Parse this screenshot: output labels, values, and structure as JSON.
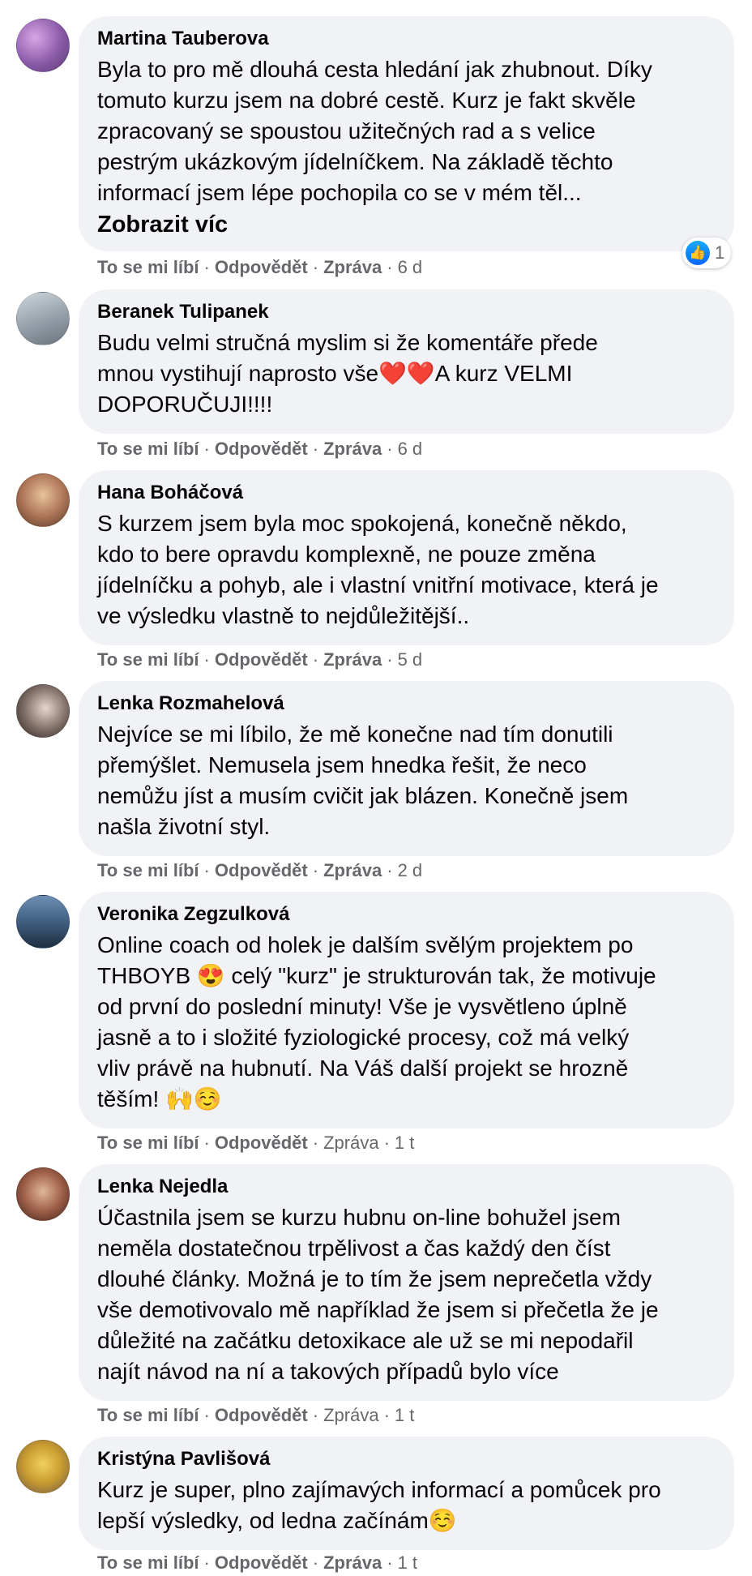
{
  "colors": {
    "bubble": "#f0f2f5",
    "text": "#050505",
    "meta": "#65676b",
    "like_blue": "#0866ff"
  },
  "top_fragment": "· · · ·",
  "comments": [
    {
      "name": "Martina Tauberova",
      "lines": [
        "Byla to pro mě dlouhá cesta hledání jak zhubnout. Díky",
        "tomuto kurzu jsem na dobré cestě. Kurz je fakt skvěle",
        "zpracovaný se spoustou užitečných rad a s velice",
        "pestrým ukázkovým jídelníčkem. Na základě těchto",
        "informací jsem lépe pochopila co se v mém těl..."
      ],
      "see_more": "Zobrazit víc",
      "like": "To se mi líbí",
      "reply": "Odpovědět",
      "message": "Zpráva",
      "time": "6 d",
      "reaction_icon": "thumbs-up-icon",
      "reaction_count": "1"
    },
    {
      "name": "Beranek Tulipanek",
      "lines": [
        "Budu velmi stručná myslim si že komentáře přede",
        "mnou vystihují naprosto vše❤️❤️A kurz VELMI",
        "DOPORUČUJI!!!!"
      ],
      "like": "To se mi líbí",
      "reply": "Odpovědět",
      "message": "Zpráva",
      "time": "6 d"
    },
    {
      "name": "Hana Boháčová",
      "lines": [
        "S kurzem jsem byla moc spokojená, konečně někdo,",
        "kdo to bere opravdu komplexně, ne pouze změna",
        "jídelníčku a pohyb, ale i vlastní vnitřní motivace, která je",
        "ve výsledku vlastně to nejdůležitější.."
      ],
      "like": "To se mi líbí",
      "reply": "Odpovědět",
      "message": "Zpráva",
      "time": "5 d"
    },
    {
      "name": "Lenka Rozmahelová",
      "lines": [
        "Nejvíce se mi líbilo, že mě konečne nad tím donutili",
        "přemýšlet. Nemusela jsem hnedka řešit, že neco",
        "nemůžu jíst a musím cvičit jak blázen. Konečně jsem",
        "našla životní styl."
      ],
      "like": "To se mi líbí",
      "reply": "Odpovědět",
      "message": "Zpráva",
      "time": "2 d"
    },
    {
      "name": "Veronika Zegzulková",
      "lines": [
        "Online coach od holek je dalším svělým projektem po",
        "THBOYB 😍 celý \"kurz\" je strukturován tak, že motivuje",
        "od první do poslední minuty! Vše je vysvětleno úplně",
        "jasně a to i složité fyziologické procesy, což má velký",
        "vliv právě na hubnutí. Na Váš další projekt se hrozně",
        "těším! 🙌☺️"
      ],
      "like": "To se mi líbí",
      "reply": "Odpovědět",
      "message": "Zpráva",
      "time": "1 t"
    },
    {
      "name": "Lenka Nejedla",
      "lines": [
        "Účastnila jsem se kurzu hubnu on-line bohužel jsem",
        "neměla dostatečnou trpělivost a čas každý den číst",
        "dlouhé články. Možná je to tím že jsem neprečetla vždy",
        "vše demotivovalo mě například že jsem si přečetla že je",
        "důležité na začátku detoxikace ale už se mi nepodařil",
        "najít návod na ní a takových případů bylo více"
      ],
      "like": "To se mi líbí",
      "reply": "Odpovědět",
      "message": "Zpráva",
      "time": "1 t"
    },
    {
      "name": "Kristýna Pavlišová",
      "lines": [
        "Kurz je super, plno zajímavých informací a pomůcek pro",
        "lepší výsledky, od ledna začínám☺️"
      ],
      "like": "To se mi líbí",
      "reply": "Odpovědět",
      "message": "Zpráva",
      "time": "1 t"
    }
  ]
}
